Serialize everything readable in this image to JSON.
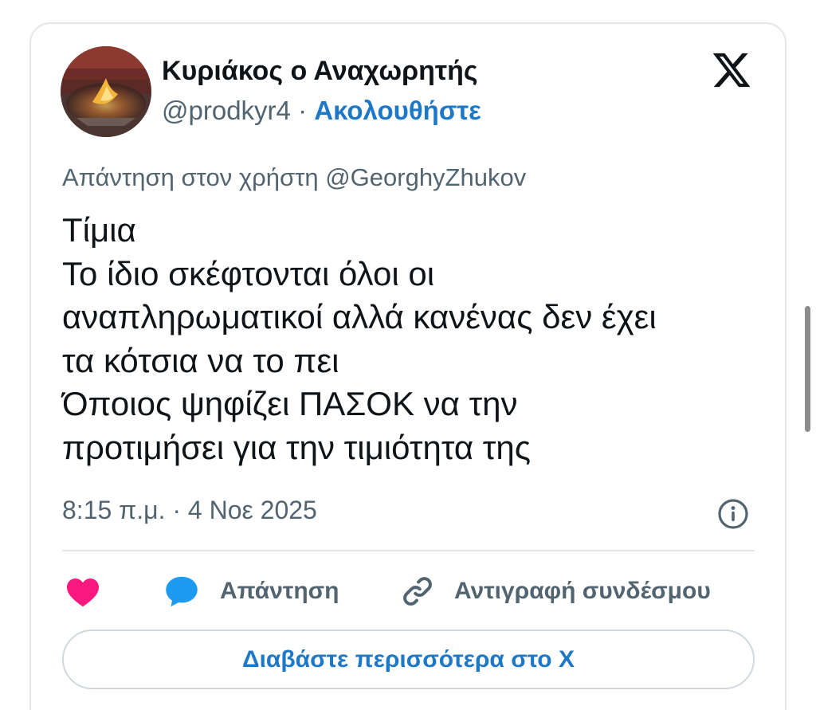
{
  "author": {
    "display_name": "Κυριάκος ο Αναχωρητής",
    "handle": "@prodkyr4",
    "separator": "·",
    "follow_label": "Ακολουθήστε",
    "avatar_icon": "flame-avatar"
  },
  "logo_icon": "x-logo-icon",
  "tweet": {
    "reply_to": "Απάντηση στον χρήστη @GeorghyZhukov",
    "lines": [
      "Τίμια",
      "Το ίδιο σκέφτονται όλοι οι",
      "αναπληρωματικοί αλλά κανένας δεν έχει",
      "τα κότσια να το πει",
      "Όποιος ψηφίζει ΠΑΣΟΚ να την",
      "προτιμήσει για την τιμιότητα της"
    ],
    "timestamp": "8:15 π.μ. · 4 Νοε 2025"
  },
  "actions": {
    "like_icon": "heart-icon",
    "reply_icon": "speech-bubble-icon",
    "reply_label": "Απάντηση",
    "copy_icon": "link-icon",
    "copy_label": "Αντιγραφή συνδέσμου"
  },
  "read_more_label": "Διαβάστε περισσότερα στο X",
  "colors": {
    "accent": "#1d78c8",
    "heart": "#f91880",
    "text": "#0f1419",
    "muted": "#536471"
  }
}
